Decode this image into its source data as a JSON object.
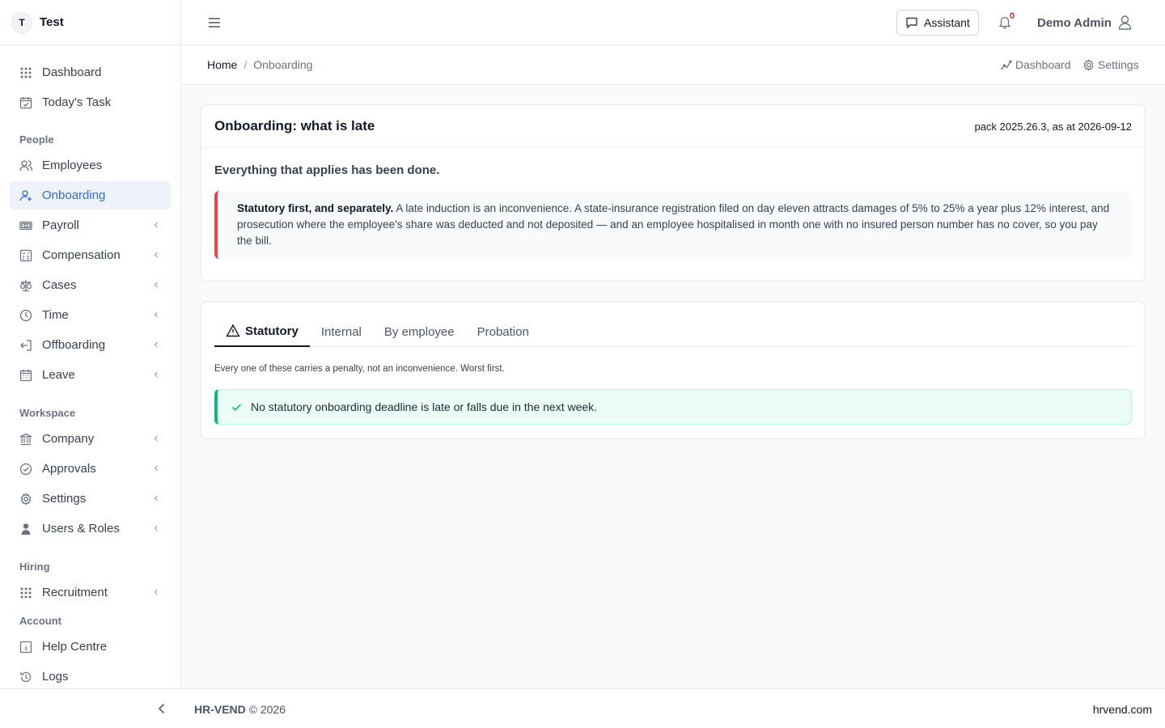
{
  "brand": {
    "initial": "T",
    "name": "Test"
  },
  "sidebar": {
    "top_items": [
      {
        "label": "Dashboard",
        "icon": "grid-icon"
      },
      {
        "label": "Today's Task",
        "icon": "calendar-check-icon"
      }
    ],
    "sections": {
      "people": "People",
      "workspace": "Workspace",
      "hiring": "Hiring",
      "account": "Account"
    },
    "people_items": [
      {
        "label": "Employees",
        "icon": "users-icon"
      },
      {
        "label": "Onboarding",
        "icon": "user-plus-icon",
        "active": true
      },
      {
        "label": "Payroll",
        "icon": "money-icon"
      },
      {
        "label": "Compensation",
        "icon": "calculator-icon"
      },
      {
        "label": "Cases",
        "icon": "scale-icon"
      },
      {
        "label": "Time",
        "icon": "clock-icon"
      },
      {
        "label": "Offboarding",
        "icon": "logout-icon"
      },
      {
        "label": "Leave",
        "icon": "calendar-icon"
      }
    ],
    "workspace_items": [
      {
        "label": "Company",
        "icon": "bank-icon"
      },
      {
        "label": "Approvals",
        "icon": "check-circle-icon"
      },
      {
        "label": "Settings",
        "icon": "gear-icon"
      },
      {
        "label": "Users & Roles",
        "icon": "user-shield-icon"
      }
    ],
    "hiring_items": [
      {
        "label": "Recruitment",
        "icon": "grid-icon"
      }
    ],
    "account_items": [
      {
        "label": "Help Centre",
        "icon": "info-icon"
      },
      {
        "label": "Logs",
        "icon": "history-icon"
      }
    ]
  },
  "topbar": {
    "assistant_label": "Assistant",
    "notification_count": "0",
    "user_name": "Demo Admin"
  },
  "breadcrumb": {
    "home": "Home",
    "separator": "/",
    "current": "Onboarding"
  },
  "quick_links": {
    "dashboard": "Dashboard",
    "settings": "Settings"
  },
  "late_card": {
    "title": "Onboarding: what is late",
    "meta": "pack 2025.26.3, as at 2026-09-12",
    "summary": "Everything that applies has been done.",
    "callout_bold": "Statutory first, and separately.",
    "callout_text": " A late induction is an inconvenience. A state-insurance registration filed on day eleven attracts damages of 5% to 25% a year plus 12% interest, and prosecution where the employee's share was deducted and not deposited — and an employee hospitalised in month one with no insured person number has no cover, so you pay the bill."
  },
  "tabs_card": {
    "tabs": [
      "Statutory",
      "Internal",
      "By employee",
      "Probation"
    ],
    "active_tab": "Statutory",
    "description": "Every one of these carries a penalty, not an inconvenience. Worst first.",
    "success_message": "No statutory onboarding deadline is late or falls due in the next week."
  },
  "footer": {
    "brand": "HR-VEND",
    "copyright": "© 2026",
    "site": "hrvend.com"
  },
  "colors": {
    "accent": "#2f6ed6",
    "danger": "#ef4444",
    "success": "#10b981"
  }
}
